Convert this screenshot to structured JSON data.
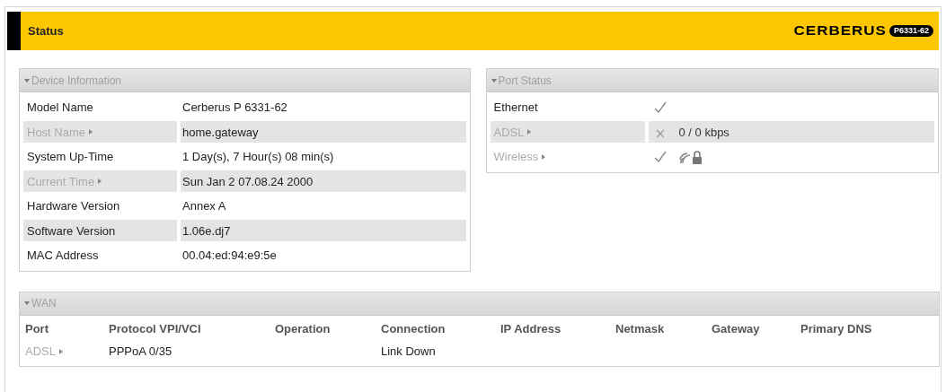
{
  "header": {
    "title": "Status",
    "logo": "CERBERUS",
    "model_badge": "P6331-62"
  },
  "device_information": {
    "title": "Device Information",
    "expanded": true,
    "rows": [
      {
        "label": "Model Name",
        "value": "Cerberus P 6331-62",
        "kind": "plain"
      },
      {
        "label": "Host Name",
        "value": "home.gateway",
        "kind": "link"
      },
      {
        "label": "System Up-Time",
        "value": "1 Day(s), 7 Hour(s) 08 min(s)",
        "kind": "plain"
      },
      {
        "label": "Current Time",
        "value": "Sun Jan 2 07.08.24 2000",
        "kind": "link"
      },
      {
        "label": "Hardware Version",
        "value": "Annex A",
        "kind": "plain"
      },
      {
        "label": "Software Version",
        "value": "1.06e.dj7",
        "kind": "plain"
      },
      {
        "label": "MAC Address",
        "value": "00.04:ed:94:e9:5e",
        "kind": "plain"
      }
    ]
  },
  "port_status": {
    "title": "Port Status",
    "expanded": true,
    "rows": [
      {
        "label": "Ethernet",
        "kind": "plain",
        "up": true
      },
      {
        "label": "ADSL",
        "kind": "link",
        "up": false,
        "detail": "0 / 0 kbps"
      },
      {
        "label": "Wireless",
        "kind": "link",
        "up": true,
        "secured": true
      }
    ]
  },
  "wan": {
    "title": "WAN",
    "expanded": true,
    "columns": [
      "Port",
      "Protocol VPI/VCI",
      "Operation",
      "Connection",
      "IP Address",
      "Netmask",
      "Gateway",
      "Primary DNS"
    ],
    "rows": [
      {
        "kind": "link",
        "cells": [
          "ADSL",
          "PPPoA 0/35",
          "",
          "Link Down",
          "",
          "",
          "",
          ""
        ]
      }
    ]
  }
}
